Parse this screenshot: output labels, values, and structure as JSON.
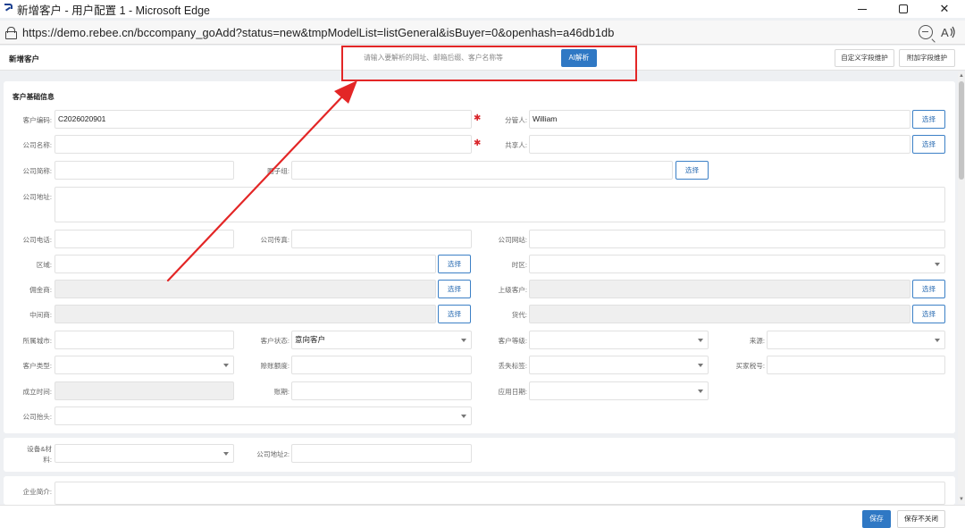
{
  "window": {
    "title": "新增客户 - 用户配置 1 - Microsoft Edge",
    "url": "https://demo.rebee.cn/bccompany_goAdd?status=new&tmpModelList=listGeneral&isBuyer=0&openhash=a46db1db",
    "close_glyph": "✕"
  },
  "header": {
    "page_title": "新增客户",
    "ai_placeholder": "请输入要解析的网址、邮箱后缀、客户名称等",
    "ai_button": "AI解析",
    "custom_fields_button": "自定义字段维护",
    "extra_fields_button": "附加字段维护"
  },
  "section": {
    "title": "客户基础信息"
  },
  "labels": {
    "customer_code": "客户编码:",
    "manager": "分管人:",
    "company_name": "公司名称:",
    "sharer": "共享人:",
    "short_name": "公司简称:",
    "group": "圈子组:",
    "address": "公司地址:",
    "phone": "公司电话:",
    "fax": "公司传真:",
    "website": "公司网站:",
    "region": "区域:",
    "timezone": "时区:",
    "commission": "佣金商:",
    "parent_customer": "上级客户:",
    "middleman": "中间商:",
    "forwarder": "货代:",
    "city": "所属城市:",
    "status": "客户状态:",
    "level": "客户等级:",
    "source": "来源:",
    "type": "客户类型:",
    "credit": "赊账额度:",
    "loss_tag": "丢失标签:",
    "tax_no": "买家税号:",
    "founded": "成立时间:",
    "account_period": "账期:",
    "apply_date": "应用日期:",
    "letterhead": "公司抬头:",
    "equipment_1": "设备&材",
    "equipment_2": "料:",
    "address2": "公司地址2:",
    "intro": "企业简介:"
  },
  "values": {
    "customer_code": "C2026020901",
    "manager": "William",
    "status": "意向客户"
  },
  "buttons": {
    "select": "选择"
  },
  "required_mark": "✱",
  "footer": {
    "save": "保存",
    "save_keep": "保存不关闭"
  },
  "colors": {
    "primary": "#2f78c4",
    "annotation": "#e32626"
  },
  "icons": [
    "app-logo-icon",
    "lock-icon",
    "zoom-out-icon",
    "read-aloud-icon",
    "chevron-down-icon"
  ]
}
